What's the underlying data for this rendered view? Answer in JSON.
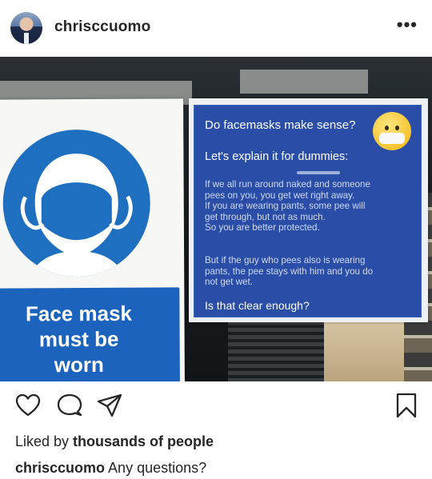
{
  "header": {
    "username": "chrisccuomo",
    "more_label": "•••"
  },
  "photo": {
    "left_sign": {
      "text": "Face mask\nmust be\nworn"
    },
    "right_sign": {
      "question": "Do facemasks make sense?",
      "heading": "Let's explain it for dummies:",
      "body1": "If we all run around naked and someone\npees on you, you get wet right away.\nIf you are wearing pants, some pee will\nget through, but not as much.\nSo you are better protected.",
      "body2": "But if the guy who pees also is wearing\npants, the pee stays with him and you do\nnot get wet.",
      "closing": "Is that clear enough?"
    }
  },
  "actions": {
    "like_icon": "heart-icon",
    "comment_icon": "comment-icon",
    "share_icon": "send-icon",
    "save_icon": "bookmark-icon"
  },
  "likes": {
    "prefix": "Liked by ",
    "who": "thousands of people"
  },
  "caption": {
    "username": "chrisccuomo",
    "text": " Any questions?"
  }
}
